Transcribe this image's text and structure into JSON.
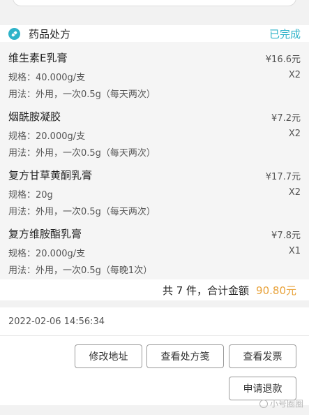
{
  "section": {
    "title": "药品处方",
    "status": "已完成",
    "icon": "pill-icon",
    "accent_color": "#2fb3c9"
  },
  "drugs": [
    {
      "name": "维生素E乳膏",
      "price": "¥16.6元",
      "spec": "规格：40.000g/支",
      "qty": "X2",
      "usage": "用法：外用，一次0.5g（每天两次）"
    },
    {
      "name": "烟酰胺凝胶",
      "price": "¥7.2元",
      "spec": "规格：20.000g/支",
      "qty": "X2",
      "usage": "用法：外用，一次0.5g（每天两次）"
    },
    {
      "name": "复方甘草黄酮乳膏",
      "price": "¥17.7元",
      "spec": "规格：20g",
      "qty": "X2",
      "usage": "用法：外用，一次0.5g（每天两次）"
    },
    {
      "name": "复方维胺酯乳膏",
      "price": "¥7.8元",
      "spec": "规格：20.000g/支",
      "qty": "X1",
      "usage": "用法：外用，一次0.5g（每晚1次）"
    }
  ],
  "totals": {
    "label": "共 7 件，合计金额",
    "amount": "90.80元",
    "amount_color": "#e8a23a"
  },
  "order": {
    "datetime": "2022-02-06 14:56:34"
  },
  "actions": {
    "modify_address": "修改地址",
    "view_prescription": "查看处方笺",
    "view_invoice": "查看发票",
    "request_refund": "申请退款"
  },
  "watermark": "小号圈圈"
}
